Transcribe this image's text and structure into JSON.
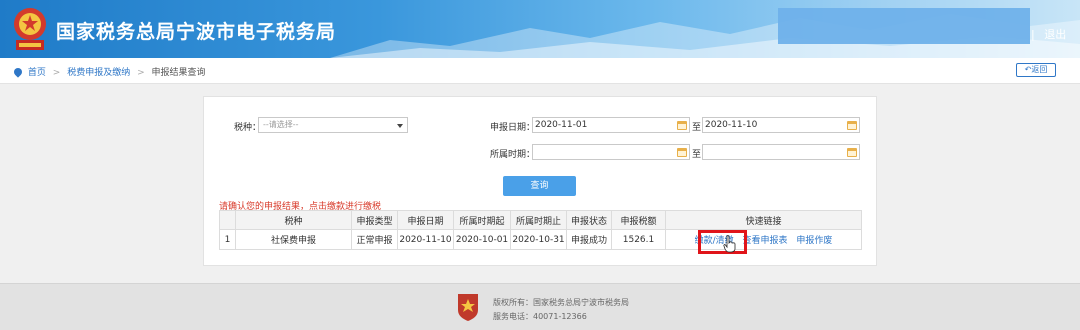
{
  "header": {
    "title": "国家税务总局宁波市电子税务局",
    "emblem_icon": "tax-emblem-icon",
    "separator": "|",
    "logout_label": "退出"
  },
  "breadcrumb": {
    "home": "首页",
    "level2": "税费申报及缴纳",
    "current": "申报结果查询"
  },
  "back_button": {
    "label": "返回",
    "icon": "return-arrow-icon"
  },
  "form": {
    "tax_type_label": "税种：",
    "tax_type_placeholder": "--请选择--",
    "declare_date_label": "申报日期：",
    "declare_date_from": "2020-11-01",
    "to_label": "至",
    "declare_date_to": "2020-11-10",
    "period_label": "所属时期：",
    "period_from": "",
    "period_to": "",
    "query_button": "查询"
  },
  "notice": "请确认您的申报结果，点击缴款进行缴税",
  "table": {
    "headers": [
      "",
      "税种",
      "申报类型",
      "申报日期",
      "所属时期起",
      "所属时期止",
      "申报状态",
      "申报税额",
      "快速链接"
    ],
    "rows": [
      {
        "index": "1",
        "tax_type": "社保费申报",
        "declare_type": "正常申报",
        "declare_date": "2020-11-10",
        "period_start": "2020-10-01",
        "period_end": "2020-10-31",
        "status": "申报成功",
        "amount": "1526.1",
        "links": [
          "缴款/清缴",
          "查看申报表",
          "申报作废"
        ]
      }
    ]
  },
  "footer": {
    "copyright": "版权所有：国家税务总局宁波市税务局",
    "phone": "服务电话：40071-12366"
  },
  "colors": {
    "header_blue": "#1f7bc8",
    "link_blue": "#2f77c7",
    "button_blue": "#4aa0e8",
    "notice_red": "#d83a2a",
    "highlight_red": "#e0141a",
    "calendar_gold": "#e8b04a"
  }
}
